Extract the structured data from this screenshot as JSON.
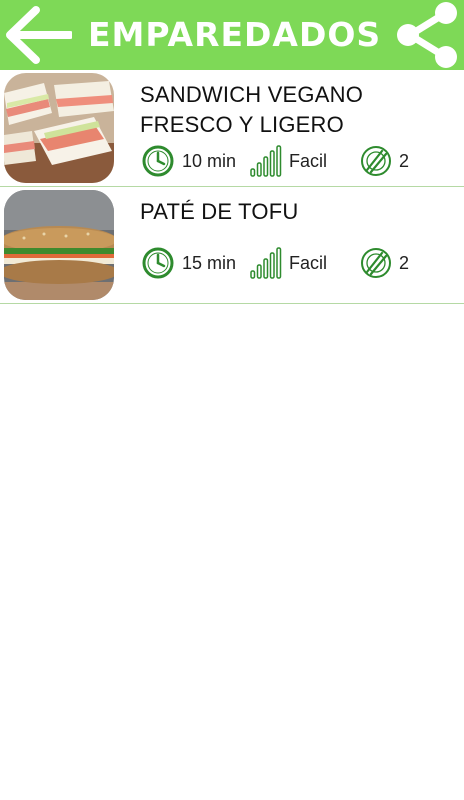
{
  "header": {
    "title": "EMPAREDADOS",
    "back_icon": "arrow-left-icon",
    "share_icon": "share-icon",
    "background": "#7ed957"
  },
  "recipes": [
    {
      "title": "SANDWICH VEGANO FRESCO Y LIGERO",
      "time": "10 min",
      "difficulty": "Facil",
      "servings": "2",
      "image": "club sandwich triangles photo"
    },
    {
      "title": "PATÉ DE TOFU",
      "time": "15 min",
      "difficulty": "Facil",
      "servings": "2",
      "image": "whole grain baguette sandwich photo"
    }
  ],
  "colors": {
    "accent": "#7ed957",
    "icon_green": "#2e8b2e",
    "divider": "#b5d9a4"
  }
}
